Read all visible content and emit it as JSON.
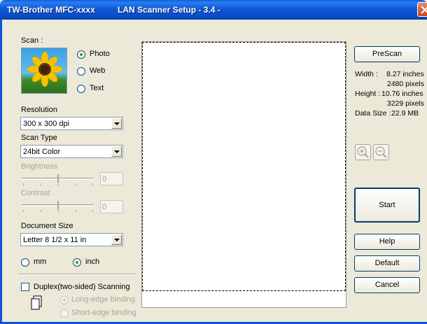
{
  "window": {
    "app_title": "TW-Brother MFC-xxxx",
    "dialog_title": "LAN Scanner Setup - 3.4 -",
    "close_icon": "close-icon"
  },
  "scan": {
    "label": "Scan :",
    "thumbnail_icon": "sunflower-photo-icon",
    "options": [
      {
        "label": "Photo",
        "selected": true
      },
      {
        "label": "Web",
        "selected": false
      },
      {
        "label": "Text",
        "selected": false
      }
    ]
  },
  "resolution": {
    "label": "Resolution",
    "value": "300 x 300 dpi"
  },
  "scan_type": {
    "label": "Scan Type",
    "value": "24bit Color"
  },
  "brightness": {
    "label": "Brightness",
    "value": "0",
    "level": 0.5,
    "enabled": false
  },
  "contrast": {
    "label": "Contrast",
    "value": "0",
    "level": 0.5,
    "enabled": false
  },
  "document_size": {
    "label": "Document Size",
    "value": "Letter 8 1/2 x 11 in"
  },
  "units": {
    "mm": "mm",
    "inch": "inch",
    "selected": "inch"
  },
  "duplex": {
    "label": "Duplex(two-sided) Scanning",
    "checked": false,
    "doc_icon": "duplex-document-icon",
    "long_edge": "Long-edge binding",
    "short_edge": "Short-edge binding",
    "selected": "long"
  },
  "buttons": {
    "prescan": "PreScan",
    "start": "Start",
    "help": "Help",
    "default": "Default",
    "cancel": "Cancel"
  },
  "info": {
    "width_label": "Width :",
    "width_inches": "8.27 inches",
    "width_pixels": "2480 pixels",
    "height_label": "Height :",
    "height_inches": "10.76 inches",
    "height_pixels": "3229 pixels",
    "datasize_label": "Data Size :",
    "datasize_value": "22.9 MB"
  },
  "zoom": {
    "zoom_in_icon": "zoom-in-icon",
    "zoom_out_icon": "zoom-out-icon"
  },
  "colors": {
    "titlebar": "#0b55d4",
    "dialog_bg": "#ece9d8",
    "close_button": "#c9421c"
  }
}
